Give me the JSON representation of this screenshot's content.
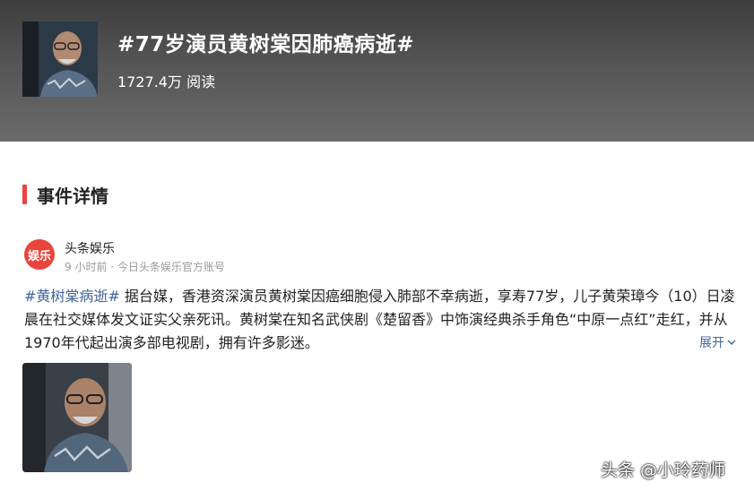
{
  "topic": {
    "title": "#77岁演员黄树棠因肺癌病逝#",
    "reads": "1727.4万 阅读"
  },
  "section": {
    "title": "事件详情",
    "accent_color": "#f04142"
  },
  "author": {
    "avatar_text": "娱乐",
    "name": "头条娱乐",
    "meta": "9 小时前 · 今日头条娱乐官方账号"
  },
  "article": {
    "hashtag": "#黄树棠病逝#",
    "body": " 据台媒，香港资深演员黄树棠因癌细胞侵入肺部不幸病逝，享寿77岁，儿子黄荣璋今（10）日凌晨在社交媒体发文证实父亲死讯。黄树棠在知名武侠剧《楚留香》中饰演经典杀手角色“中原一点红”走红，并从1970年代起出演多部电视剧，拥有许多影迷。",
    "expand_label": "展开",
    "link_color": "#406599"
  },
  "watermark": "头条 @小玲药师",
  "icons": {
    "expand": "chevron-down-icon"
  }
}
